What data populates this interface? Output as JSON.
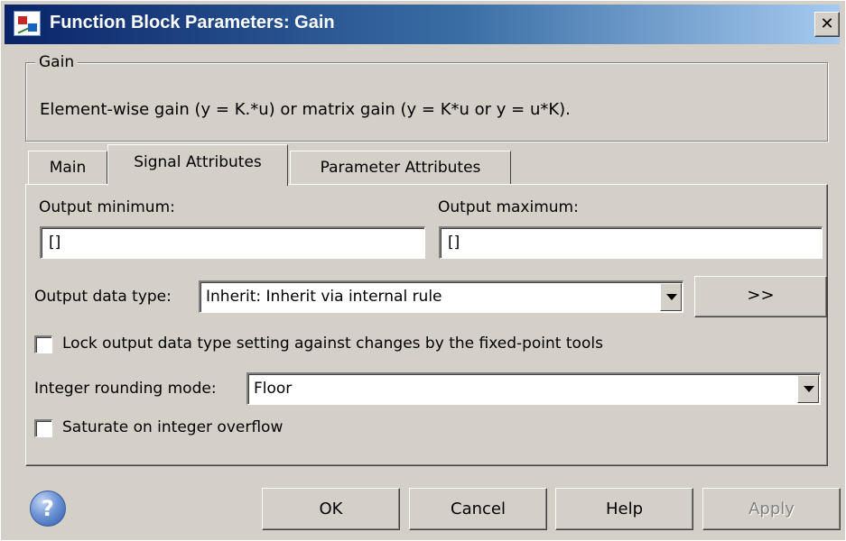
{
  "window": {
    "title": "Function Block Parameters: Gain",
    "close_glyph": "✕"
  },
  "block": {
    "name": "Gain",
    "description": "Element-wise gain (y = K.*u) or matrix gain (y = K*u or y = u*K)."
  },
  "tabs": [
    {
      "label": "Main",
      "active": false
    },
    {
      "label": "Signal Attributes",
      "active": true
    },
    {
      "label": "Parameter Attributes",
      "active": false
    }
  ],
  "signal_attributes": {
    "output_minimum_label": "Output minimum:",
    "output_minimum_value": "[]",
    "output_maximum_label": "Output maximum:",
    "output_maximum_value": "[]",
    "output_data_type_label": "Output data type:",
    "output_data_type_value": "Inherit: Inherit via internal rule",
    "data_type_assistant_button": ">>",
    "lock_output_label": "Lock output data type setting against changes by the fixed-point tools",
    "lock_output_checked": false,
    "rounding_mode_label": "Integer rounding mode:",
    "rounding_mode_value": "Floor",
    "saturate_label": "Saturate on integer overflow",
    "saturate_checked": false
  },
  "buttons": {
    "ok": "OK",
    "cancel": "Cancel",
    "help": "Help",
    "apply": "Apply",
    "apply_enabled": false
  },
  "help_icon_glyph": "?",
  "colors": {
    "dialog_face": "#d4d0c8",
    "titlebar_start": "#0a246a",
    "titlebar_end": "#a6caf0"
  }
}
